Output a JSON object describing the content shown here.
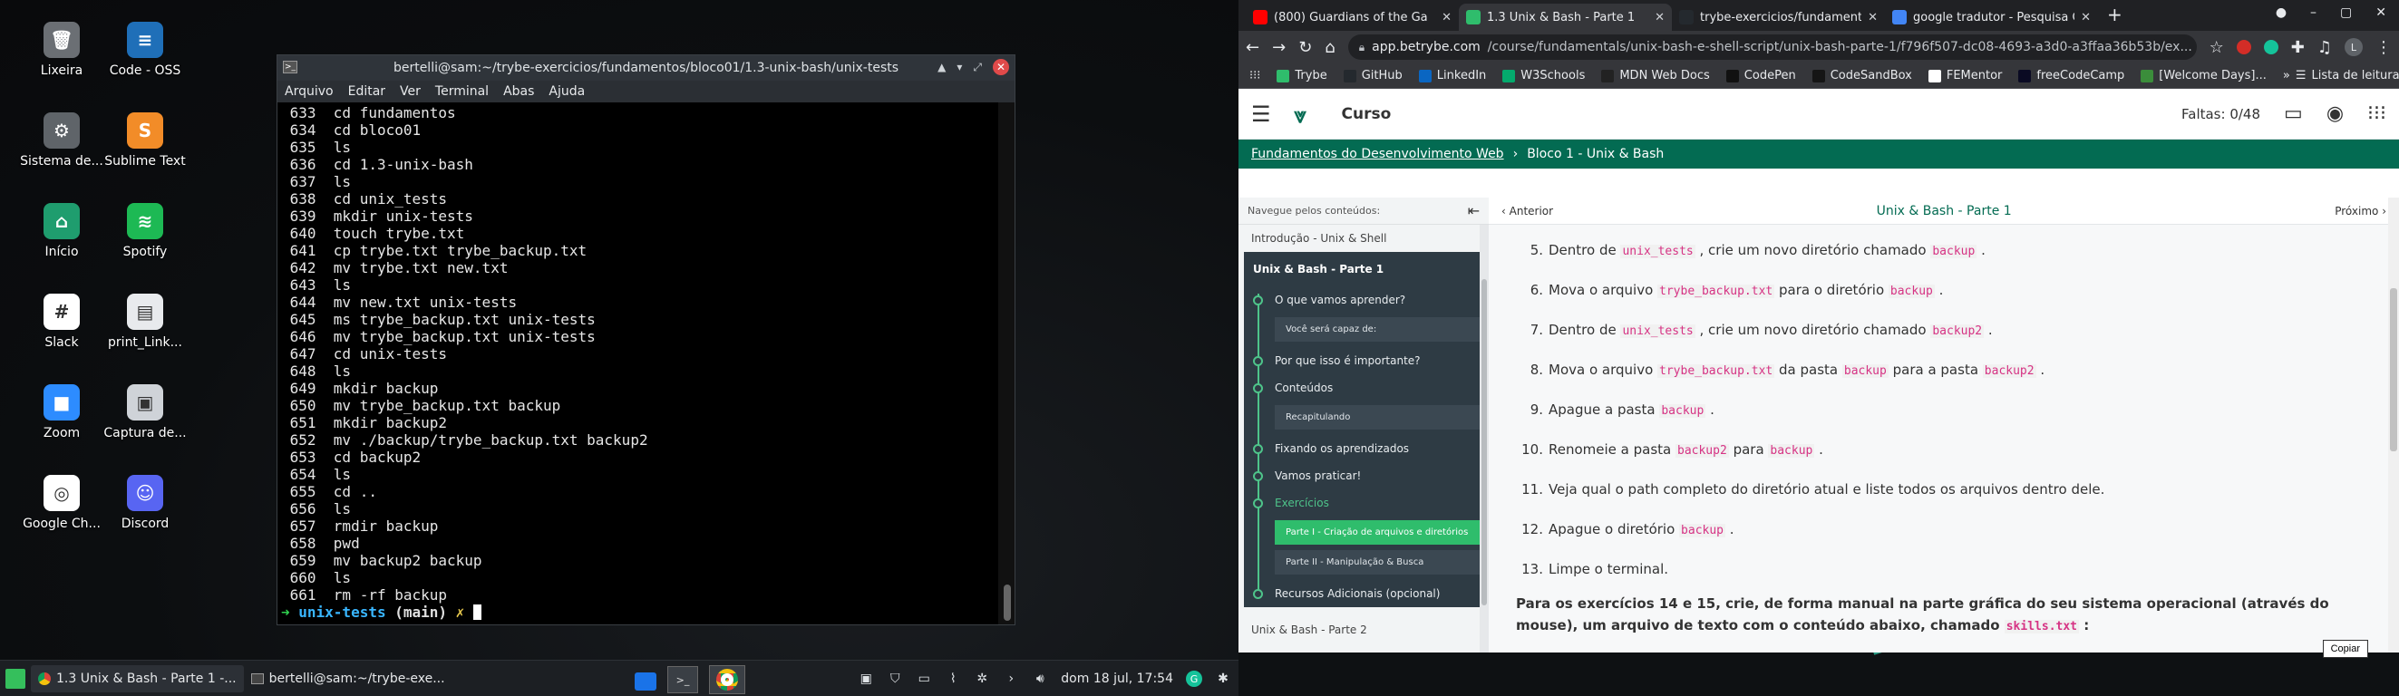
{
  "desktop": {
    "icons": [
      {
        "label": "Lixeira",
        "icon": "trash-icon"
      },
      {
        "label": "Code - OSS",
        "icon": "vscode-icon"
      },
      {
        "label": "Sistema de...",
        "icon": "system-icon"
      },
      {
        "label": "Sublime Text",
        "icon": "sublime-icon"
      },
      {
        "label": "Início",
        "icon": "home-folder-icon"
      },
      {
        "label": "Spotify",
        "icon": "spotify-icon"
      },
      {
        "label": "Slack",
        "icon": "slack-icon"
      },
      {
        "label": "print_Link...",
        "icon": "image-file-icon"
      },
      {
        "label": "Zoom",
        "icon": "zoom-icon"
      },
      {
        "label": "Captura de...",
        "icon": "screenshot-icon"
      },
      {
        "label": "Google Ch...",
        "icon": "chrome-icon"
      },
      {
        "label": "Discord",
        "icon": "discord-icon"
      }
    ]
  },
  "terminal": {
    "title": "bertelli@sam:~/trybe-exercicios/fundamentos/bloco01/1.3-unix-bash/unix-tests",
    "menu": [
      "Arquivo",
      "Editar",
      "Ver",
      "Terminal",
      "Abas",
      "Ajuda"
    ],
    "history": [
      " 633  cd fundamentos",
      " 634  cd bloco01",
      " 635  ls",
      " 636  cd 1.3-unix-bash",
      " 637  ls",
      " 638  cd unix_tests",
      " 639  mkdir unix-tests",
      " 640  touch trybe.txt",
      " 641  cp trybe.txt trybe_backup.txt",
      " 642  mv trybe.txt new.txt",
      " 643  ls",
      " 644  mv new.txt unix-tests",
      " 645  ms trybe_backup.txt unix-tests",
      " 646  mv trybe_backup.txt unix-tests",
      " 647  cd unix-tests",
      " 648  ls",
      " 649  mkdir backup",
      " 650  mv trybe_backup.txt backup",
      " 651  mkdir backup2",
      " 652  mv ./backup/trybe_backup.txt backup2",
      " 653  cd backup2",
      " 654  ls",
      " 655  cd ..",
      " 656  ls",
      " 657  rmdir backup",
      " 658  pwd",
      " 659  mv backup2 backup",
      " 660  ls",
      " 661  rm -rf backup"
    ],
    "prompt": {
      "arrow": "➜",
      "dir": "unix-tests",
      "branch": "(main)",
      "dirty": "✗"
    }
  },
  "taskbar": {
    "items": [
      {
        "label": "1.3 Unix & Bash - Parte 1 -..."
      },
      {
        "label": "bertelli@sam:~/trybe-exe..."
      }
    ],
    "clock": "dom 18 jul, 17:54"
  },
  "browser": {
    "tabs": [
      {
        "label": "(800) Guardians of the Ga",
        "favicon_color": "#ff0000"
      },
      {
        "label": "1.3 Unix & Bash - Parte 1",
        "favicon_color": "#2fbd6c"
      },
      {
        "label": "trybe-exercicios/fundament",
        "favicon_color": "#24292e"
      },
      {
        "label": "google tradutor - Pesquisa G",
        "favicon_color": "#4285f4"
      }
    ],
    "url_host": "app.betrybe.com",
    "url_path": "/course/fundamentals/unix-bash-e-shell-script/unix-bash-parte-1/f796f507-dc08-4693-a3d0-a3ffaa36b53b/ex...",
    "bookmarks": [
      "Trybe",
      "GitHub",
      "LinkedIn",
      "W3Schools",
      "MDN Web Docs",
      "CodePen",
      "CodeSandBox",
      "FEMentor",
      "freeCodeCamp",
      "[Welcome Days]..."
    ],
    "reading_list": "Lista de leitura"
  },
  "page": {
    "header": {
      "title": "Curso",
      "absences": "Faltas: 0/48"
    },
    "breadcrumb": {
      "root": "Fundamentos do Desenvolvimento Web",
      "sep": "›",
      "current": "Bloco 1 - Unix & Bash"
    },
    "sidenav": {
      "heading": "Navegue pelos conteúdos:",
      "prev_item": "Introdução - Unix & Shell",
      "section_title": "Unix & Bash - Parte 1",
      "subitems": [
        {
          "label": "O que vamos aprender?",
          "children": [
            "Você será capaz de:"
          ]
        },
        {
          "label": "Por que isso é importante?",
          "children": []
        },
        {
          "label": "Conteúdos",
          "children": [
            "Recapitulando"
          ]
        },
        {
          "label": "Fixando os aprendizados",
          "children": []
        },
        {
          "label": "Vamos praticar!",
          "children": []
        },
        {
          "label": "Exercícios",
          "children": [
            "Parte I - Criação de arquivos e diretórios",
            "Parte II - Manipulação & Busca"
          ]
        },
        {
          "label": "Recursos Adicionais (opcional)",
          "children": []
        }
      ],
      "next_item": "Unix & Bash - Parte 2"
    },
    "pager": {
      "prev": "Anterior",
      "title": "Unix & Bash - Parte 1",
      "next": "Próximo"
    },
    "exercises": [
      {
        "n": "5.",
        "parts": [
          "Dentro de ",
          "#unix_tests",
          " , crie um novo diretório chamado ",
          "#backup",
          " ."
        ]
      },
      {
        "n": "6.",
        "parts": [
          "Mova o arquivo ",
          "#trybe_backup.txt",
          " para o diretório ",
          "#backup",
          " ."
        ]
      },
      {
        "n": "7.",
        "parts": [
          "Dentro de ",
          "#unix_tests",
          " , crie um novo diretório chamado ",
          "#backup2",
          " ."
        ]
      },
      {
        "n": "8.",
        "parts": [
          "Mova o arquivo ",
          "#trybe_backup.txt",
          " da pasta ",
          "#backup",
          " para a pasta ",
          "#backup2",
          " ."
        ]
      },
      {
        "n": "9.",
        "parts": [
          "Apague a pasta ",
          "#backup",
          " ."
        ]
      },
      {
        "n": "10.",
        "parts": [
          "Renomeie a pasta ",
          "#backup2",
          " para ",
          "#backup",
          " ."
        ]
      },
      {
        "n": "11.",
        "parts": [
          "Veja qual o path completo do diretório atual e liste todos os arquivos dentro dele."
        ]
      },
      {
        "n": "12.",
        "parts": [
          "Apague o diretório ",
          "#backup",
          " ."
        ]
      },
      {
        "n": "13.",
        "parts": [
          "Limpe o terminal."
        ]
      }
    ],
    "paragraph_before": "Para os exercícios 14 e 15, crie, de forma manual na parte gráfica do seu sistema operacional (através do mouse), um arquivo de texto com o conteúdo abaixo, chamado ",
    "paragraph_code": "skills.txt",
    "paragraph_after": " :",
    "copy_label": "Copiar"
  },
  "colors": {
    "trybe_green": "#036b52",
    "nav_dark": "#2e3b44",
    "nav_selected": "#2fbd6c",
    "code_pink": "#d63384"
  }
}
